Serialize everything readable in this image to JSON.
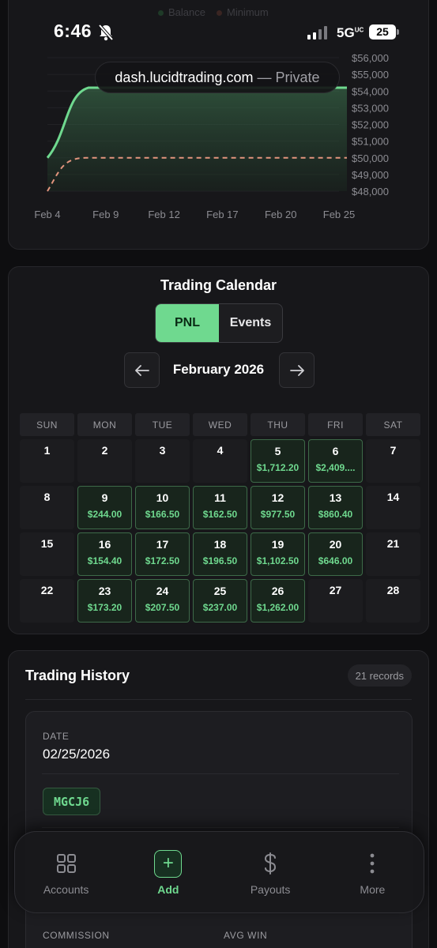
{
  "status": {
    "time": "6:46",
    "network": "5G",
    "network_sup": "UC",
    "battery": "25",
    "legend_balance": "Balance",
    "legend_minimum": "Minimum"
  },
  "browser": {
    "host": "dash.lucidtrading.com",
    "separator": "—",
    "mode": "Private"
  },
  "chart_data": {
    "type": "area",
    "x": [
      "Feb 4",
      "Feb 9",
      "Feb 12",
      "Feb 17",
      "Feb 20",
      "Feb 25"
    ],
    "y_ticks": [
      "$56,000",
      "$55,000",
      "$54,000",
      "$53,000",
      "$52,000",
      "$51,000",
      "$50,000",
      "$49,000",
      "$48,000"
    ],
    "ylim": [
      48000,
      56000
    ],
    "series": [
      {
        "name": "Balance",
        "color": "#6fd98f",
        "values": [
          50000,
          54200,
          54200,
          54200,
          54200,
          54200
        ]
      },
      {
        "name": "Minimum",
        "color": "#e3957e",
        "values": [
          48000,
          50000,
          50000,
          50000,
          50000,
          50000
        ],
        "style": "dashed"
      }
    ],
    "grid": true
  },
  "calendar": {
    "title": "Trading Calendar",
    "tabs": [
      "PNL",
      "Events"
    ],
    "active_tab": "PNL",
    "month": "February 2026",
    "weekdays": [
      "SUN",
      "MON",
      "TUE",
      "WED",
      "THU",
      "FRI",
      "SAT"
    ],
    "weeks": [
      [
        {
          "day": "1",
          "pnl": ""
        },
        {
          "day": "2",
          "pnl": ""
        },
        {
          "day": "3",
          "pnl": ""
        },
        {
          "day": "4",
          "pnl": ""
        },
        {
          "day": "5",
          "pnl": "$1,712.20"
        },
        {
          "day": "6",
          "pnl": "$2,409...."
        },
        {
          "day": "7",
          "pnl": ""
        }
      ],
      [
        {
          "day": "8",
          "pnl": ""
        },
        {
          "day": "9",
          "pnl": "$244.00"
        },
        {
          "day": "10",
          "pnl": "$166.50"
        },
        {
          "day": "11",
          "pnl": "$162.50"
        },
        {
          "day": "12",
          "pnl": "$977.50"
        },
        {
          "day": "13",
          "pnl": "$860.40"
        },
        {
          "day": "14",
          "pnl": ""
        }
      ],
      [
        {
          "day": "15",
          "pnl": ""
        },
        {
          "day": "16",
          "pnl": "$154.40"
        },
        {
          "day": "17",
          "pnl": "$172.50"
        },
        {
          "day": "18",
          "pnl": "$196.50"
        },
        {
          "day": "19",
          "pnl": "$1,102.50"
        },
        {
          "day": "20",
          "pnl": "$646.00"
        },
        {
          "day": "21",
          "pnl": ""
        }
      ],
      [
        {
          "day": "22",
          "pnl": ""
        },
        {
          "day": "23",
          "pnl": "$173.20"
        },
        {
          "day": "24",
          "pnl": "$207.50"
        },
        {
          "day": "25",
          "pnl": "$237.00"
        },
        {
          "day": "26",
          "pnl": "$1,262.00"
        },
        {
          "day": "27",
          "pnl": ""
        },
        {
          "day": "28",
          "pnl": ""
        }
      ]
    ]
  },
  "history": {
    "title": "Trading History",
    "records_badge": "21 records",
    "record": {
      "date_label": "DATE",
      "date_value": "02/25/2026",
      "symbol": "MGCJ6",
      "commission_label": "COMMISSION",
      "avg_win_label": "AVG WIN"
    }
  },
  "bottom_nav": {
    "items": [
      {
        "label": "Accounts",
        "icon": "grid-icon"
      },
      {
        "label": "Add",
        "icon": "plus-icon"
      },
      {
        "label": "Payouts",
        "icon": "dollar-icon"
      },
      {
        "label": "More",
        "icon": "more-vertical-icon"
      }
    ],
    "active": "Add"
  }
}
